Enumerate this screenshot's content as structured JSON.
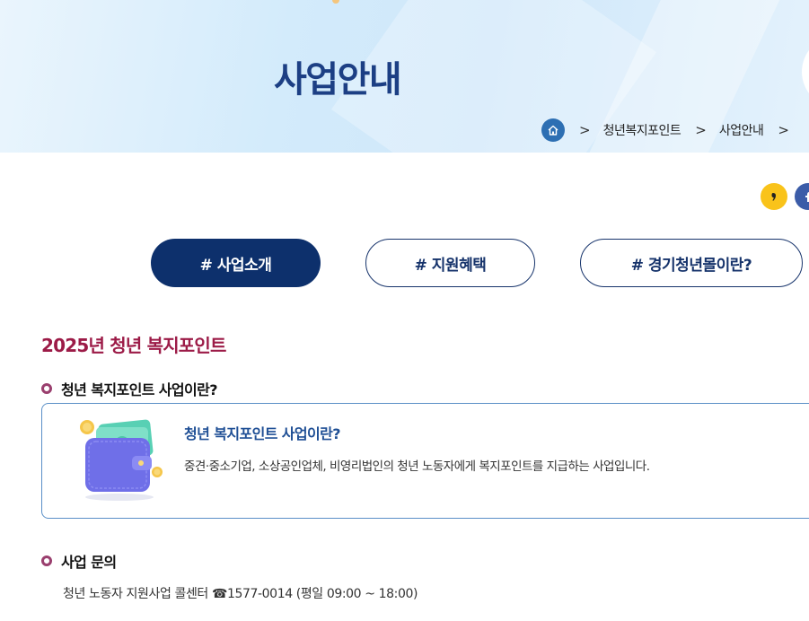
{
  "hero": {
    "title": "사업안내"
  },
  "breadcrumb": {
    "separator": ">",
    "items": [
      "청년복지포인트",
      "사업안내"
    ]
  },
  "tabs": [
    {
      "label": "# 사업소개",
      "active": true
    },
    {
      "label": "# 지원혜택",
      "active": false
    },
    {
      "label": "# 경기청년몰이란?",
      "active": false
    }
  ],
  "section": {
    "title": "2025년 청년 복지포인트"
  },
  "about": {
    "heading": "청년 복지포인트 사업이란?",
    "box_title": "청년 복지포인트 사업이란?",
    "box_desc": "중견·중소기업, 소상공인업체, 비영리법인의 청년 노동자에게 복지포인트를 지급하는 사업입니다."
  },
  "inquiry": {
    "heading": "사업 문의",
    "text": "청년 노동자 지원사업 콜센터 ☎1577-0014 (평일 09:00 ~ 18:00)"
  },
  "colors": {
    "title": "#1c3f84",
    "accent": "#9c1b47",
    "tab_active_bg": "#0d306c",
    "border": "#5a8fc7"
  },
  "icons": [
    "home-icon",
    "kakao-share-icon",
    "facebook-share-icon",
    "wallet-illustration"
  ]
}
